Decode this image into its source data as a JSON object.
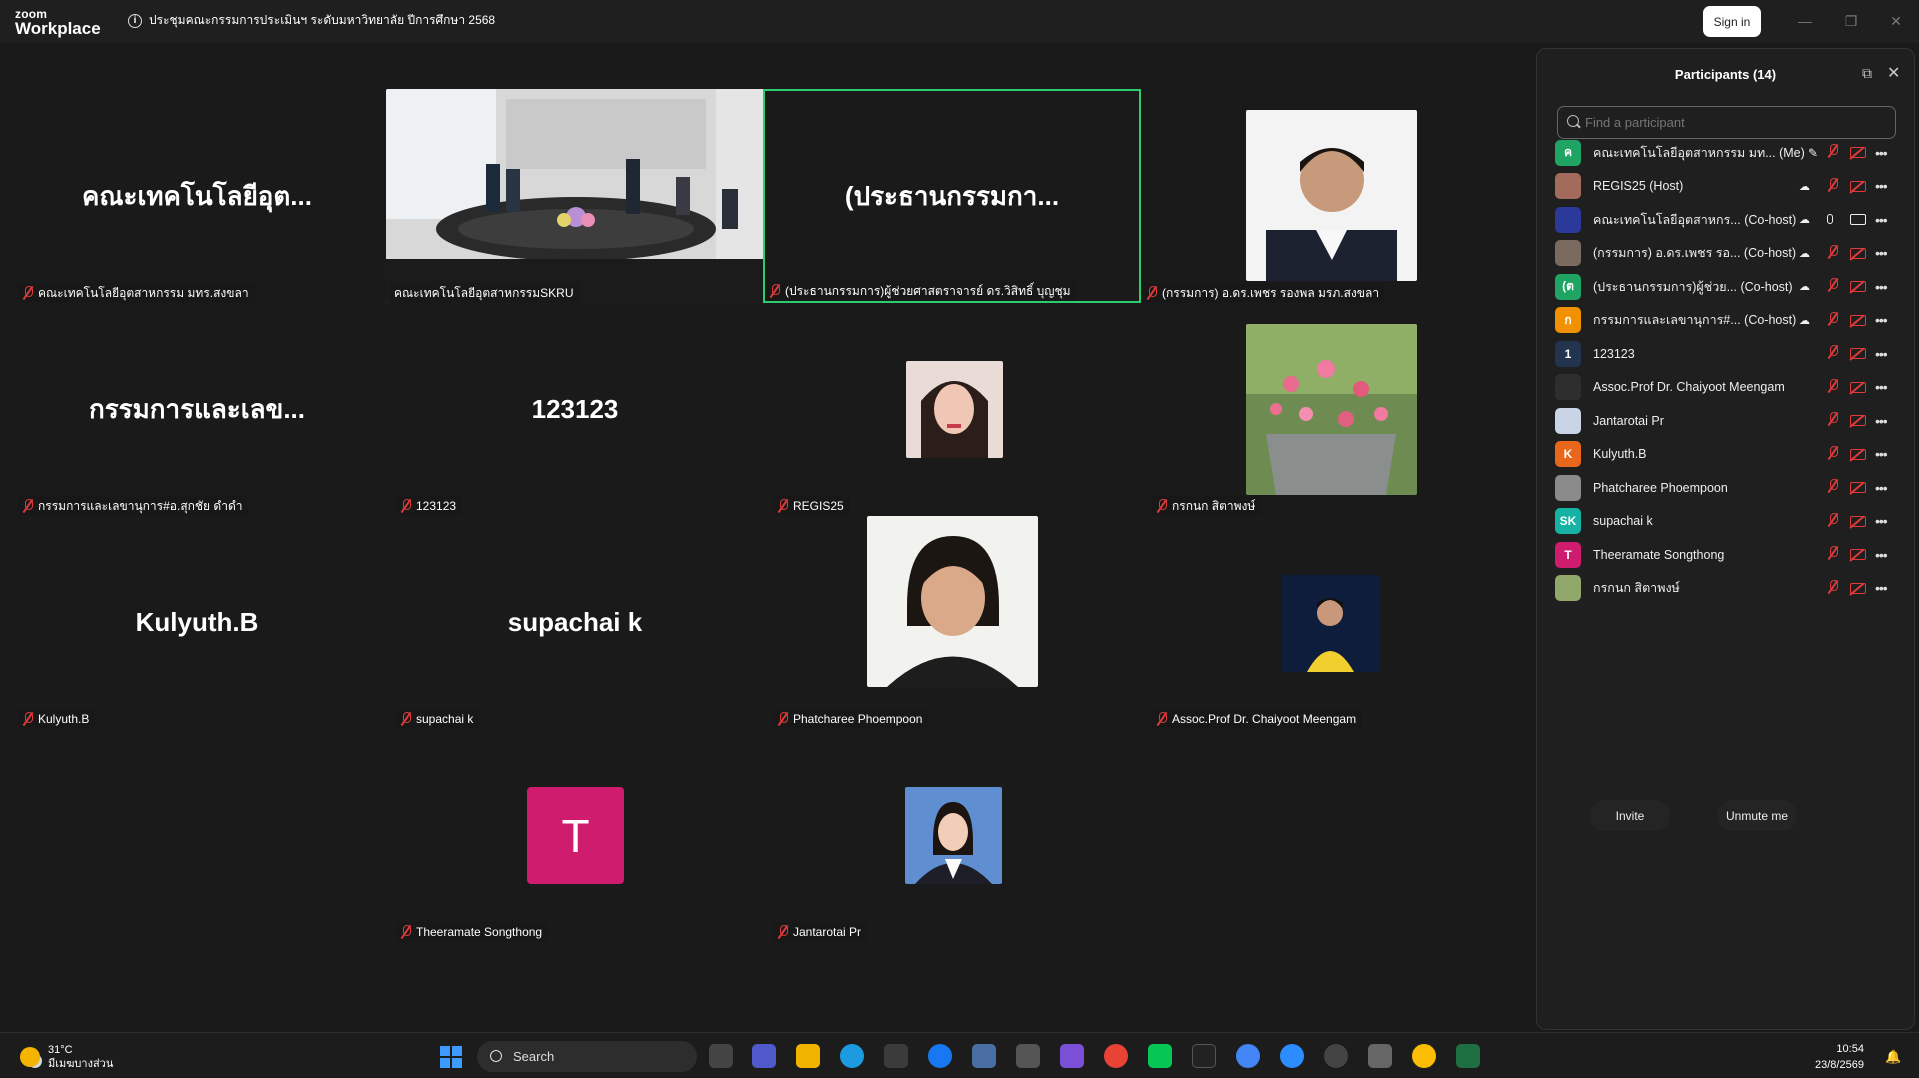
{
  "app": {
    "logo_line1": "zoom",
    "logo_line2": "Workplace"
  },
  "meeting": {
    "title": "ประชุมคณะกรรมการประเมินฯ ระดับมหาวิทยาลัย ปีการศึกษา 2568"
  },
  "titlebar": {
    "signin_label": "Sign in",
    "minimize": "—",
    "restore": "❐",
    "close": "✕"
  },
  "tiles": [
    {
      "center": "คณะเทคโนโลยีอุต...",
      "label": "คณะเทคโนโลยีอุตสาหกรรม มทร.สงขลา"
    },
    {
      "center": "",
      "label": "คณะเทคโนโลยีอุตสาหกรรมSKRU"
    },
    {
      "center": "(ประธานกรรมกา...",
      "label": "(ประธานกรรมการ)ผู้ช่วยศาสตราจารย์ ดร.วิสิทธิ์ บุญชุม"
    },
    {
      "center": "",
      "label": "(กรรมการ) อ.ดร.เพชร รองพล มรภ.สงขลา"
    },
    {
      "center": "กรรมการและเลข...",
      "label": "กรรมการและเลขานุการ#อ.สุกชัย ดำดำ"
    },
    {
      "center": "123123",
      "label": "123123"
    },
    {
      "center": "",
      "label": "REGIS25"
    },
    {
      "center": "",
      "label": "กรกนก สิตาพงษ์"
    },
    {
      "center": "Kulyuth.B",
      "label": "Kulyuth.B"
    },
    {
      "center": "supachai k",
      "label": "supachai k"
    },
    {
      "center": "",
      "label": "Phatcharee Phoempoon"
    },
    {
      "center": "",
      "label": "Assoc.Prof Dr. Chaiyoot Meengam"
    },
    {
      "center": "T",
      "label": "Theeramate Songthong"
    },
    {
      "center": "",
      "label": "Jantarotai Pr"
    }
  ],
  "panel": {
    "title": "Participants (14)",
    "search_placeholder": "Find a participant",
    "popout_icon": "popout-icon",
    "close_icon": "close-icon",
    "invite_label": "Invite",
    "unmute_label": "Unmute me",
    "participants": [
      {
        "avatar": "ค",
        "color": "#1fa463",
        "name": "คณะเทคโนโลยีอุตสาหกรรม มท... (Me)",
        "status": "pencil"
      },
      {
        "avatar": "",
        "color": "#a36b5b",
        "name": "REGIS25 (Host)",
        "status": "cloud"
      },
      {
        "avatar": "",
        "color": "#2b3a9a",
        "name": "คณะเทคโนโลยีอุตสาหกร...  (Co-host)",
        "status": "cloud-live"
      },
      {
        "avatar": "",
        "color": "#7a6a60",
        "name": "(กรรมการ) อ.ดร.เพชร รอ... (Co-host)",
        "status": "cloud"
      },
      {
        "avatar": "(ต",
        "color": "#1fa463",
        "name": "(ประธานกรรมการ)ผู้ช่วย...  (Co-host)",
        "status": "cloud"
      },
      {
        "avatar": "ก",
        "color": "#f29100",
        "name": "กรรมการและเลขานุการ#...  (Co-host)",
        "status": "cloud"
      },
      {
        "avatar": "1",
        "color": "#22344f",
        "name": "123123",
        "status": ""
      },
      {
        "avatar": "",
        "color": "#2e2e2e",
        "name": "Assoc.Prof Dr. Chaiyoot Meengam",
        "status": ""
      },
      {
        "avatar": "",
        "color": "#c9d4e6",
        "name": "Jantarotai Pr",
        "status": ""
      },
      {
        "avatar": "K",
        "color": "#e8671c",
        "name": "Kulyuth.B",
        "status": ""
      },
      {
        "avatar": "",
        "color": "#8b8b8b",
        "name": "Phatcharee Phoempoon",
        "status": ""
      },
      {
        "avatar": "SK",
        "color": "#16b3a4",
        "name": "supachai k",
        "status": ""
      },
      {
        "avatar": "T",
        "color": "#d01c6e",
        "name": "Theeramate Songthong",
        "status": ""
      },
      {
        "avatar": "",
        "color": "#8fa86a",
        "name": "กรกนก สิตาพงษ์",
        "status": ""
      }
    ]
  },
  "taskbar": {
    "temp": "31°C",
    "weather_desc": "มีเมฆบางส่วน",
    "search_label": "Search",
    "time": "10:54",
    "date": "23/8/2569"
  }
}
